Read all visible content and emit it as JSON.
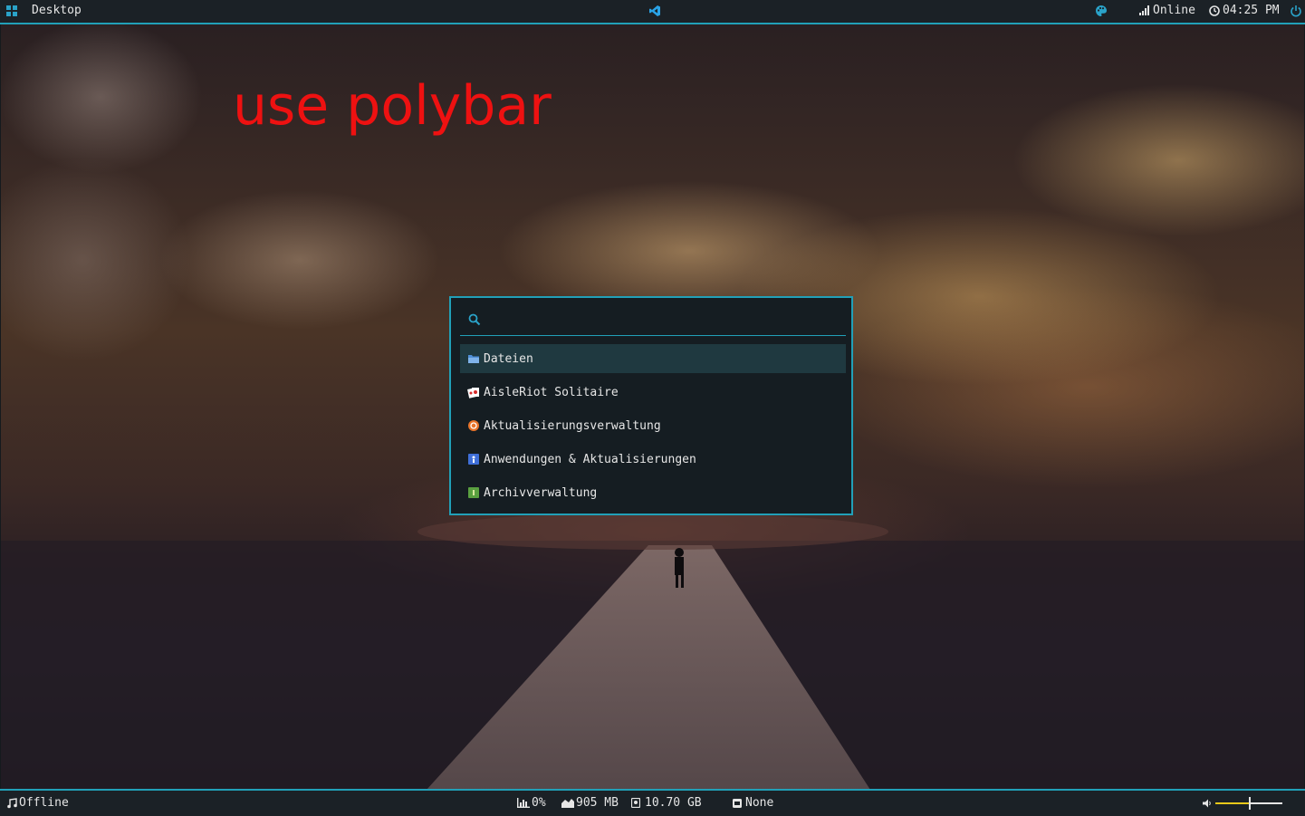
{
  "wallpaper": {
    "overlay_text": "use polybar"
  },
  "topbar": {
    "workspace_icon": "grid-icon",
    "workspace_label": "Desktop",
    "center_icon": "vscode-icon",
    "palette_icon": "palette-icon",
    "network_icon": "signal-bars-icon",
    "network_status": "Online",
    "clock_icon": "clock-icon",
    "time": "04:25 PM",
    "power_icon": "power-icon"
  },
  "launcher": {
    "search_icon": "search-icon",
    "search_value": "",
    "results": [
      {
        "label": "Dateien",
        "icon": "folder-icon",
        "selected": true
      },
      {
        "label": "AisleRiot Solitaire",
        "icon": "cards-icon",
        "selected": false
      },
      {
        "label": "Aktualisierungsverwaltung",
        "icon": "update-manager-icon",
        "selected": false
      },
      {
        "label": "Anwendungen & Aktualisierungen",
        "icon": "software-sources-icon",
        "selected": false
      },
      {
        "label": "Archivverwaltung",
        "icon": "archive-icon",
        "selected": false
      }
    ]
  },
  "bottombar": {
    "music_icon": "music-note-icon",
    "music_status": "Offline",
    "cpu_icon": "cpu-bars-icon",
    "cpu": "0%",
    "memory_icon": "memory-chart-icon",
    "memory": "905 MB",
    "disk_icon": "disk-icon",
    "disk": "10.70 GB",
    "keyboard_icon": "keyboard-icon",
    "keyboard": "None",
    "volume_icon": "speaker-icon",
    "volume_level": 0.5
  },
  "colors": {
    "accent": "#21a0b8",
    "bar_bg": "#1b2126",
    "launcher_bg": "#151d22",
    "selected_bg": "#1f3940",
    "volume_fill": "#e8c81a",
    "overlay_text": "#ee1111"
  }
}
